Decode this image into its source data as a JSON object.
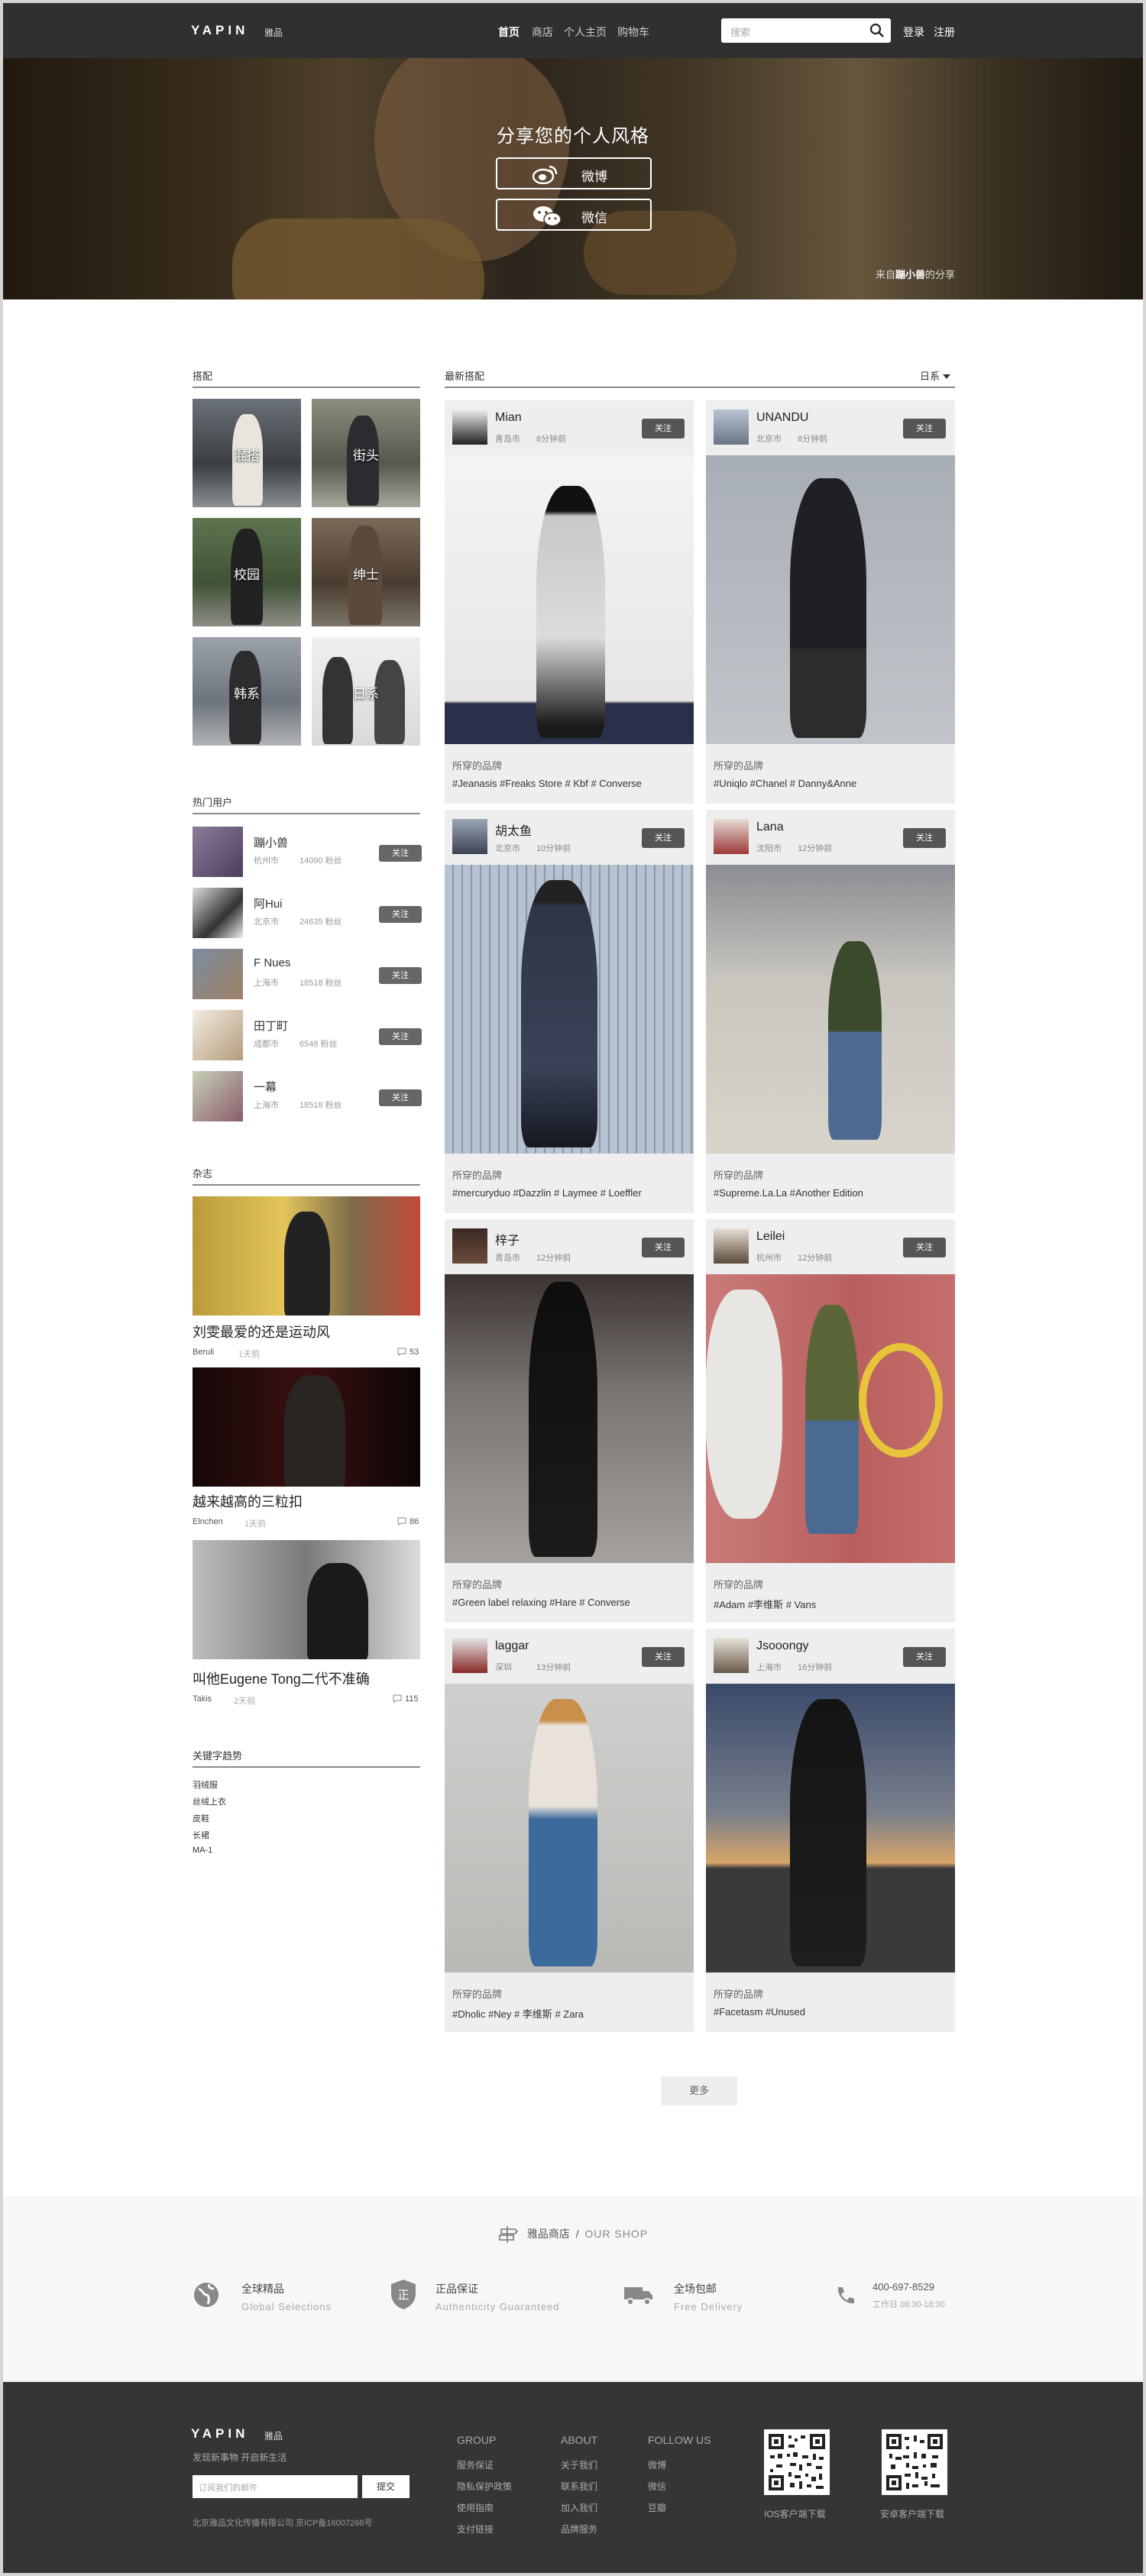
{
  "header": {
    "logo": "YAPIN",
    "logo_sub": "雅品",
    "nav": [
      "首页",
      "商店",
      "个人主页",
      "购物车"
    ],
    "search_placeholder": "搜索",
    "login": "登录",
    "register": "注册"
  },
  "hero": {
    "title": "分享您的个人风格",
    "share_weibo": "微博",
    "share_wechat": "微信",
    "credit_prefix": "来自",
    "credit_user": "蹦小兽",
    "credit_suffix": "的分享"
  },
  "sidebar": {
    "tags_title": "搭配",
    "tags": [
      "混搭",
      "街头",
      "校园",
      "绅士",
      "韩系",
      "日系"
    ],
    "hot_users_title": "热门用户",
    "users": [
      {
        "name": "蹦小兽",
        "city": "杭州市",
        "fans": "14090 粉丝",
        "follow": "关注"
      },
      {
        "name": "阿Hui",
        "city": "北京市",
        "fans": "24635 粉丝",
        "follow": "关注"
      },
      {
        "name": "F Nues",
        "city": "上海市",
        "fans": "18518 粉丝",
        "follow": "关注"
      },
      {
        "name": "田丁町",
        "city": "成都市",
        "fans": "6548 粉丝",
        "follow": "关注"
      },
      {
        "name": "一幕",
        "city": "上海市",
        "fans": "18518 粉丝",
        "follow": "关注"
      }
    ],
    "magazine_title": "杂志",
    "magazine": [
      {
        "title": "刘雯最爱的还是运动风",
        "author": "Beruli",
        "time": "1天前",
        "comments": "53"
      },
      {
        "title": "越来越高的三粒扣",
        "author": "Elnchen",
        "time": "1天前",
        "comments": "86"
      },
      {
        "title": "叫他Eugene Tong二代不准确",
        "author": "Takis",
        "time": "2天前",
        "comments": "115"
      }
    ],
    "keywords_title": "关键字趋势",
    "keywords": [
      "羽绒服",
      "丝绒上衣",
      "皮鞋",
      "长裙",
      "MA-1"
    ]
  },
  "feed": {
    "title": "最新搭配",
    "filter": "日系",
    "brand_label": "所穿的品牌",
    "follow": "关注",
    "cards": [
      {
        "name": "Mian",
        "city": "青岛市",
        "time": "8分钟前",
        "brands": [
          "#Jeanasis",
          "#Freaks Store",
          "# Kbf",
          "# Converse"
        ]
      },
      {
        "name": "UNANDU",
        "city": "北京市",
        "time": "8分钟前",
        "brands": [
          "#Uniqlo",
          "#Chanel",
          "# Danny&Anne"
        ]
      },
      {
        "name": "胡太鱼",
        "city": "北京市",
        "time": "10分钟前",
        "brands": [
          "#mercuryduo",
          "#Dazzlin",
          "# Laymee",
          "# Loeffler"
        ]
      },
      {
        "name": "Lana",
        "city": "沈阳市",
        "time": "12分钟前",
        "brands": [
          "#Supreme.La.La",
          "#Another Edition"
        ]
      },
      {
        "name": "梓子",
        "city": "青岛市",
        "time": "12分钟前",
        "brands": [
          "#Green label relaxing",
          "#Hare",
          "# Converse"
        ]
      },
      {
        "name": "Leilei",
        "city": "杭州市",
        "time": "12分钟前",
        "brands": [
          "#Adam",
          "#李维斯",
          "# Vans"
        ]
      },
      {
        "name": "laggar",
        "city": "深圳",
        "time": "13分钟前",
        "brands": [
          "#Dholic",
          "#Ney",
          "# 李维斯",
          "# Zara"
        ]
      },
      {
        "name": "Jsooongy",
        "city": "上海市",
        "time": "16分钟前",
        "brands": [
          "#Facetasm",
          "#Unused"
        ]
      }
    ],
    "more": "更多"
  },
  "shop": {
    "title_cn": "雅品商店",
    "sep": "/",
    "title_en": "OUR SHOP",
    "features": [
      {
        "title": "全球精品",
        "sub": "Global Selections"
      },
      {
        "title": "正品保证",
        "sub": "Authenticity Guaranteed"
      },
      {
        "title": "全场包邮",
        "sub": "Free Delivery"
      }
    ],
    "phone": "400-697-8529",
    "hours": "工作日 08:30-18:30"
  },
  "footer": {
    "logo": "YAPIN",
    "logo_sub": "雅品",
    "slogan": "发现新事物 开启新生活",
    "email_placeholder": "订阅我们的邮件",
    "submit": "提交",
    "copyright": "北京雅品文化传播有限公司   京ICP备16007268号",
    "columns": [
      {
        "title": "GROUP",
        "links": [
          "服务保证",
          "隐私保护政策",
          "使用指南",
          "支付链接"
        ]
      },
      {
        "title": "ABOUT",
        "links": [
          "关于我们",
          "联系我们",
          "加入我们",
          "品牌服务"
        ]
      },
      {
        "title": "FOLLOW US",
        "links": [
          "微博",
          "微信",
          "豆瓣"
        ]
      }
    ],
    "qr_ios": "IOS客户端下载",
    "qr_android": "安卓客户端下载"
  },
  "colors": {
    "header_bg": "#303030",
    "footer_bg": "#353535",
    "card_bg": "#eeeeee",
    "button": "#555555"
  }
}
